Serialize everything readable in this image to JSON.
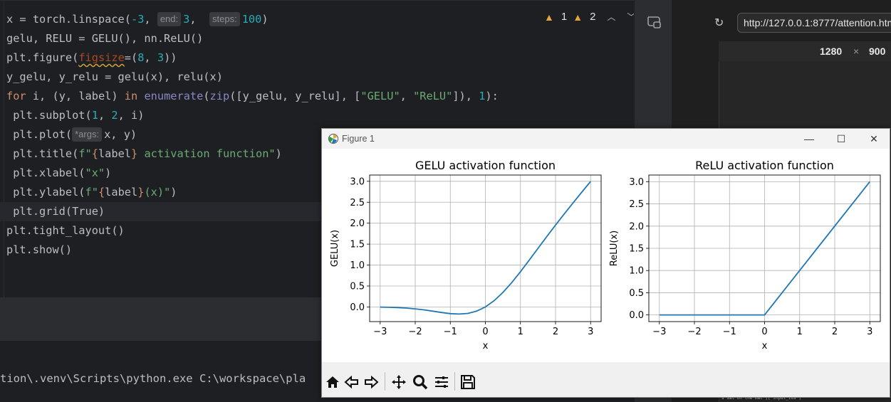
{
  "editor": {
    "lines": [
      [
        {
          "t": "x = torch.linspace(",
          "c": ""
        },
        {
          "t": "-3",
          "c": "num"
        },
        {
          "t": ", ",
          "c": ""
        },
        {
          "hint": "end:"
        },
        {
          "t": "3",
          "c": "num"
        },
        {
          "t": ",  ",
          "c": ""
        },
        {
          "hint": "steps:"
        },
        {
          "t": "100",
          "c": "num"
        },
        {
          "t": ")",
          "c": ""
        }
      ],
      [
        {
          "t": "gelu, RELU = GELU(), nn.ReLU()",
          "c": ""
        }
      ],
      [
        {
          "t": "plt.figure(",
          "c": ""
        },
        {
          "t": "figsize",
          "c": "par"
        },
        {
          "t": "=(",
          "c": ""
        },
        {
          "t": "8",
          "c": "num"
        },
        {
          "t": ", ",
          "c": ""
        },
        {
          "t": "3",
          "c": "num"
        },
        {
          "t": "))",
          "c": ""
        }
      ],
      [
        {
          "t": "y_gelu, y_relu = gelu(x), relu(x)",
          "c": ""
        }
      ],
      [
        {
          "t": "for",
          "c": "kw"
        },
        {
          "t": " i, (y, label) ",
          "c": ""
        },
        {
          "t": "in",
          "c": "kw"
        },
        {
          "t": " ",
          "c": ""
        },
        {
          "t": "enumerate",
          "c": "bi"
        },
        {
          "t": "(",
          "c": ""
        },
        {
          "t": "zip",
          "c": "bi"
        },
        {
          "t": "([y_gelu, y_relu], [",
          "c": ""
        },
        {
          "t": "\"GELU\"",
          "c": "str"
        },
        {
          "t": ", ",
          "c": ""
        },
        {
          "t": "\"ReLU\"",
          "c": "str"
        },
        {
          "t": "]), ",
          "c": ""
        },
        {
          "t": "1",
          "c": "num"
        },
        {
          "t": "):",
          "c": ""
        }
      ],
      [
        {
          "t": " plt.subplot(",
          "c": ""
        },
        {
          "t": "1",
          "c": "num"
        },
        {
          "t": ", ",
          "c": ""
        },
        {
          "t": "2",
          "c": "num"
        },
        {
          "t": ", i)",
          "c": ""
        }
      ],
      [
        {
          "t": " plt.plot(",
          "c": ""
        },
        {
          "hint": "*args:"
        },
        {
          "t": "x, y)",
          "c": ""
        }
      ],
      [
        {
          "t": " plt.title(",
          "c": ""
        },
        {
          "t": "f\"",
          "c": "str"
        },
        {
          "t": "{",
          "c": "fs"
        },
        {
          "t": "label",
          "c": ""
        },
        {
          "t": "}",
          "c": "fs"
        },
        {
          "t": " activation function\"",
          "c": "str"
        },
        {
          "t": ")",
          "c": ""
        }
      ],
      [
        {
          "t": " plt.xlabel(",
          "c": ""
        },
        {
          "t": "\"x\"",
          "c": "str"
        },
        {
          "t": ")",
          "c": ""
        }
      ],
      [
        {
          "t": " plt.ylabel(",
          "c": ""
        },
        {
          "t": "f\"",
          "c": "str"
        },
        {
          "t": "{",
          "c": "fs"
        },
        {
          "t": "label",
          "c": ""
        },
        {
          "t": "}",
          "c": "fs"
        },
        {
          "t": "(x)\"",
          "c": "str"
        },
        {
          "t": ")",
          "c": ""
        }
      ],
      [
        {
          "t": " plt.grid(True)",
          "c": ""
        }
      ],
      [
        {
          "t": "plt.tight_layout()",
          "c": ""
        }
      ],
      [
        {
          "t": "plt.show()",
          "c": ""
        }
      ]
    ],
    "highlight_line": 10,
    "warnings": {
      "count_a": "1",
      "count_b": "2"
    }
  },
  "console": {
    "text": "tion\\.venv\\Scripts\\python.exe C:\\workspace\\pla"
  },
  "browser": {
    "url": "http://127.0.0.1:8777/attention.htm",
    "width": "1280",
    "times": "×",
    "height": "900",
    "tiny": "s sat on the mat\"]['input_ids']"
  },
  "figure": {
    "title": "Figure 1",
    "accent": "#1f77b4"
  },
  "chart_data": [
    {
      "type": "line",
      "title": "GELU activation function",
      "xlabel": "x",
      "ylabel": "GELU(x)",
      "xlim": [
        -3.3,
        3.3
      ],
      "ylim": [
        -0.35,
        3.15
      ],
      "xticks": [
        -3,
        -2,
        -1,
        0,
        1,
        2,
        3
      ],
      "xticklabels": [
        "−3",
        "−2",
        "−1",
        "0",
        "1",
        "2",
        "3"
      ],
      "yticks": [
        0.0,
        0.5,
        1.0,
        1.5,
        2.0,
        2.5,
        3.0
      ],
      "yticklabels": [
        "0.0",
        "0.5",
        "1.0",
        "1.5",
        "2.0",
        "2.5",
        "3.0"
      ],
      "grid": true,
      "x": [
        -3,
        -2.75,
        -2.5,
        -2.25,
        -2,
        -1.75,
        -1.5,
        -1.25,
        -1,
        -0.75,
        -0.5,
        -0.25,
        0,
        0.25,
        0.5,
        0.75,
        1,
        1.25,
        1.5,
        1.75,
        2,
        2.25,
        2.5,
        2.75,
        3
      ],
      "y": [
        -0.004,
        -0.008,
        -0.016,
        -0.028,
        -0.046,
        -0.07,
        -0.1,
        -0.132,
        -0.159,
        -0.17,
        -0.154,
        -0.1,
        0,
        0.15,
        0.346,
        0.58,
        0.841,
        1.118,
        1.4,
        1.68,
        1.955,
        2.223,
        2.484,
        2.742,
        2.996
      ]
    },
    {
      "type": "line",
      "title": "ReLU activation function",
      "xlabel": "x",
      "ylabel": "ReLU(x)",
      "xlim": [
        -3.3,
        3.3
      ],
      "ylim": [
        -0.15,
        3.15
      ],
      "xticks": [
        -3,
        -2,
        -1,
        0,
        1,
        2,
        3
      ],
      "xticklabels": [
        "−3",
        "−2",
        "−1",
        "0",
        "1",
        "2",
        "3"
      ],
      "yticks": [
        0.0,
        0.5,
        1.0,
        1.5,
        2.0,
        2.5,
        3.0
      ],
      "yticklabels": [
        "0.0",
        "0.5",
        "1.0",
        "1.5",
        "2.0",
        "2.5",
        "3.0"
      ],
      "grid": true,
      "x": [
        -3,
        0,
        3
      ],
      "y": [
        0,
        0,
        3
      ]
    }
  ]
}
